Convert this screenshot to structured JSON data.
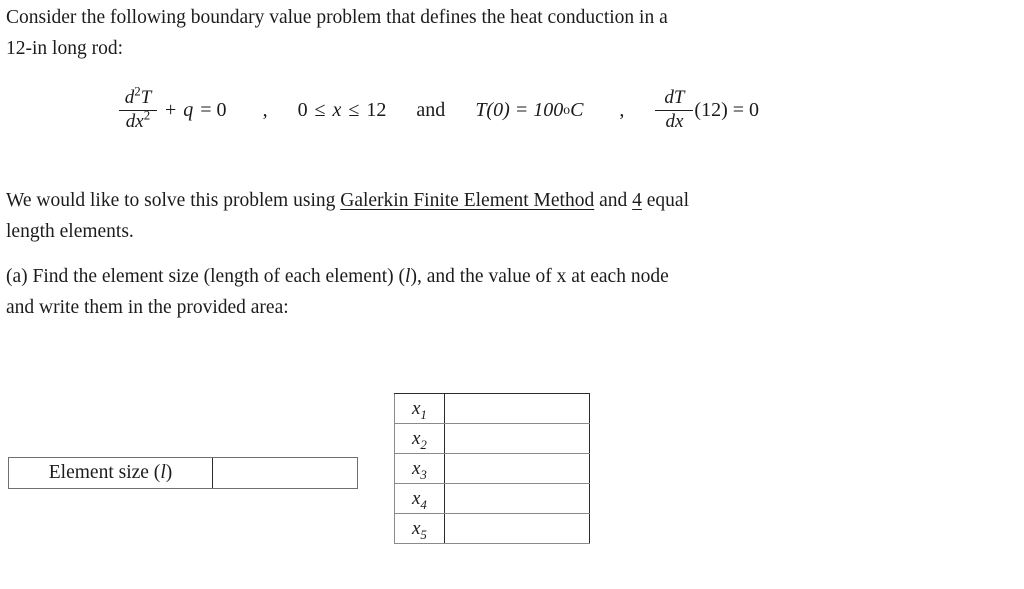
{
  "document": {
    "intro": {
      "line1": "Consider the following boundary value problem that defines the heat conduction in a",
      "line2": "12-in long rod:"
    },
    "equation": {
      "lhs_numerator_d": "d",
      "lhs_numerator_exp": "2",
      "lhs_numerator_T": "T",
      "lhs_denominator_d": "d",
      "lhs_denominator_x": "x",
      "lhs_denominator_exp": "2",
      "plus": "+",
      "source_term": "q",
      "equals_zero": "= 0",
      "comma1": ",",
      "domain_lower": "0",
      "leq1": "≤",
      "domain_var": "x",
      "leq2": "≤",
      "domain_upper": "12",
      "and": "and",
      "bc1": "T(0) = 100",
      "bc1_degree": "o",
      "bc1_unit": "C",
      "comma2": ",",
      "bc2_numerator_d": "d",
      "bc2_numerator_T": "T",
      "bc2_denominator_d": "d",
      "bc2_denominator_x": "x",
      "bc2_rest": "(12) = 0"
    },
    "method": {
      "part1": "We would like to solve this problem using ",
      "underlined_method": "Galerkin Finite Element Method",
      "part2": " and ",
      "underlined_count": "4",
      "part3": " equal",
      "line2": "length elements."
    },
    "question_a": {
      "line1_part1": "(a) Find the element size (length of each element) (",
      "line1_italic": "l",
      "line1_part2": "), and the value of x at each node",
      "line2": "and write them in the provided area:"
    }
  },
  "answer_area": {
    "element_size": {
      "label_text": "Element size (",
      "label_italic": "l",
      "label_close": ")",
      "value": "",
      "placeholder": ""
    },
    "node_table": {
      "rows": [
        {
          "label": "x",
          "sub": "1",
          "value": "",
          "placeholder": ""
        },
        {
          "label": "x",
          "sub": "2",
          "value": "",
          "placeholder": ""
        },
        {
          "label": "x",
          "sub": "3",
          "value": "",
          "placeholder": ""
        },
        {
          "label": "x",
          "sub": "4",
          "value": "",
          "placeholder": ""
        },
        {
          "label": "x",
          "sub": "5",
          "value": "",
          "placeholder": ""
        }
      ]
    }
  },
  "colors": {
    "background": "#ffffff",
    "text": "#1c1c1c",
    "border_dark": "#2b2b2b",
    "border_light": "#8a8a8a"
  }
}
